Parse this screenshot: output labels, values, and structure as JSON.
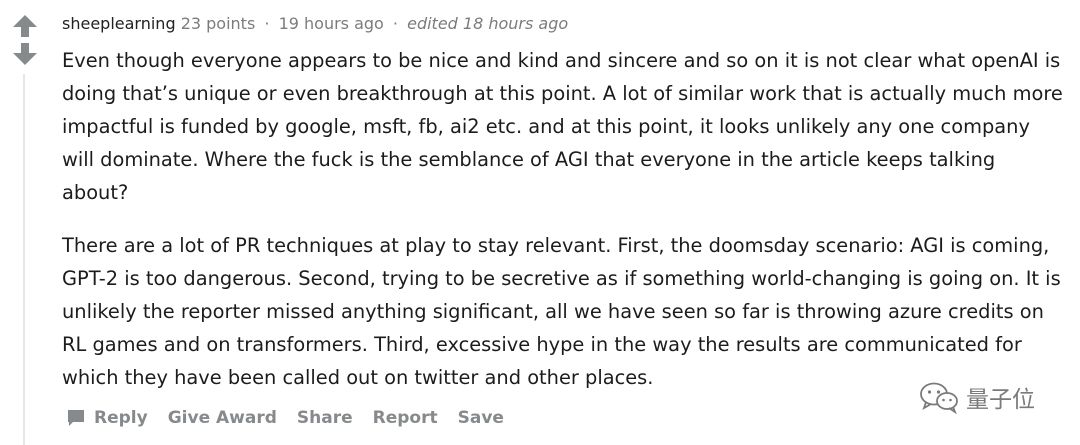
{
  "comment": {
    "author": "sheeplearning",
    "points": "23 points",
    "time": "19 hours ago",
    "edited": "edited 18 hours ago",
    "paragraphs": [
      "Even though everyone appears to be nice and kind and sincere and so on it is not clear what openAI is doing that’s unique or even breakthrough at this point. A lot of similar work that is actually much more impactful is funded by google, msft, fb, ai2 etc. and at this point, it looks unlikely any one company will dominate. Where the fuck is the semblance of AGI that everyone in the article keeps talking about?",
      "There are a lot of PR techniques at play to stay relevant. First, the doomsday scenario: AGI is coming, GPT-2 is too dangerous. Second, trying to be secretive as if something world-changing is going on. It is unlikely the reporter missed anything significant, all we have seen so far is throwing azure credits on RL games and on transformers. Third, excessive hype in the way the results are communicated for which they have been called out on twitter and other places."
    ]
  },
  "actions": {
    "reply": "Reply",
    "give_award": "Give Award",
    "share": "Share",
    "report": "Report",
    "save": "Save"
  },
  "watermark": {
    "text": "量子位"
  },
  "icons": {
    "upvote": "arrow-up-icon",
    "downvote": "arrow-down-icon",
    "reply": "comment-bubble-icon",
    "watermark": "wechat-icon"
  },
  "colors": {
    "text": "#1c1c1c",
    "meta": "#7c7c7c",
    "action": "#878a8c",
    "arrow": "#878a8c"
  }
}
